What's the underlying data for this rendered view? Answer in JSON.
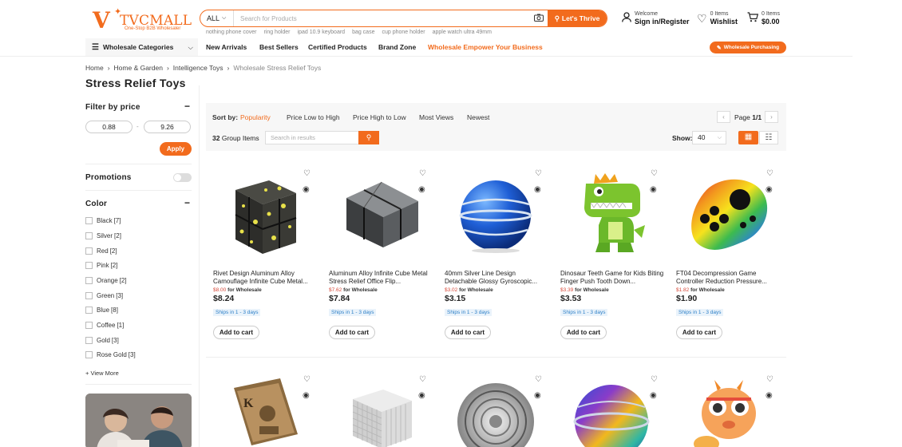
{
  "logo": {
    "mark": "V",
    "name": "TVCMALL",
    "tagline": "One-Stop B2B Wholesaler"
  },
  "search": {
    "scope": "ALL",
    "placeholder": "Search for Products",
    "button": "Let's Thrive",
    "hot": [
      "nothing phone cover",
      "ring holder",
      "ipad 10.9 keyboard",
      "bag case",
      "cup phone holder",
      "apple watch ultra 49mm"
    ]
  },
  "account": {
    "line1": "Welcome",
    "line2": "Sign in/Register"
  },
  "wishlist": {
    "line1": "0 Items",
    "line2": "Wishlist"
  },
  "cart": {
    "line1": "0 Items",
    "line2": "$0.00"
  },
  "nav": {
    "categories": "Wholesale Categories",
    "items": [
      "New Arrivals",
      "Best Sellers",
      "Certified Products",
      "Brand Zone",
      "Wholesale Empower Your Business"
    ],
    "purchasing": "Wholesale Purchasing"
  },
  "breadcrumb": [
    "Home",
    "Home & Garden",
    "Intelligence Toys",
    "Wholesale Stress Relief Toys"
  ],
  "page_title": "Stress Relief Toys",
  "filter": {
    "price_title": "Filter by price",
    "min": "0.88",
    "max": "9.26",
    "sep": "-",
    "apply": "Apply",
    "promotions": "Promotions",
    "color_title": "Color",
    "colors": [
      {
        "label": "Black",
        "count": "[7]"
      },
      {
        "label": "Silver",
        "count": "[2]"
      },
      {
        "label": "Red",
        "count": "[2]"
      },
      {
        "label": "Pink",
        "count": "[2]"
      },
      {
        "label": "Orange",
        "count": "[2]"
      },
      {
        "label": "Green",
        "count": "[3]"
      },
      {
        "label": "Blue",
        "count": "[8]"
      },
      {
        "label": "Coffee",
        "count": "[1]"
      },
      {
        "label": "Gold",
        "count": "[3]"
      },
      {
        "label": "Rose Gold",
        "count": "[3]"
      }
    ],
    "view_more": "+ View More"
  },
  "sort": {
    "label": "Sort by:",
    "options": [
      "Popularity",
      "Price Low to High",
      "Price High to Low",
      "Most Views",
      "Newest"
    ],
    "active": "Popularity"
  },
  "pager": {
    "label": "Page",
    "current": "1/1"
  },
  "results": {
    "count": "32",
    "count_label": "Group Items",
    "search_placeholder": "Search in results",
    "show_label": "Show:",
    "show_value": "40"
  },
  "products": [
    {
      "name": "Rivet Design Aluminum Alloy Camouflage Infinite Cube Metal...",
      "ws": "$8.00",
      "ws_label": "for Wholesale",
      "price": "$8.24",
      "ship": "Ships in 1 - 3 days",
      "add": "Add to cart"
    },
    {
      "name": "Aluminum Alloy Infinite Cube Metal Stress Relief Office Flip...",
      "ws": "$7.62",
      "ws_label": "for Wholesale",
      "price": "$7.84",
      "ship": "Ships in 1 - 3 days",
      "add": "Add to cart"
    },
    {
      "name": "40mm Silver Line Design Detachable Glossy Gyroscopic...",
      "ws": "$3.02",
      "ws_label": "for Wholesale",
      "price": "$3.15",
      "ship": "Ships in 1 - 3 days",
      "add": "Add to cart"
    },
    {
      "name": "Dinosaur Teeth Game for Kids Biting Finger Push Tooth Down...",
      "ws": "$3.39",
      "ws_label": "for Wholesale",
      "price": "$3.53",
      "ship": "Ships in 1 - 3 days",
      "add": "Add to cart"
    },
    {
      "name": "FT04 Decompression Game Controller Reduction Pressure...",
      "ws": "$1.82",
      "ws_label": "for Wholesale",
      "price": "$1.90",
      "ship": "Ships in 1 - 3 days",
      "add": "Add to cart"
    }
  ],
  "colors": {
    "accent": "#f26b1d",
    "ship_blue": "#2c7fc7",
    "ws_red": "#d84a3a"
  }
}
